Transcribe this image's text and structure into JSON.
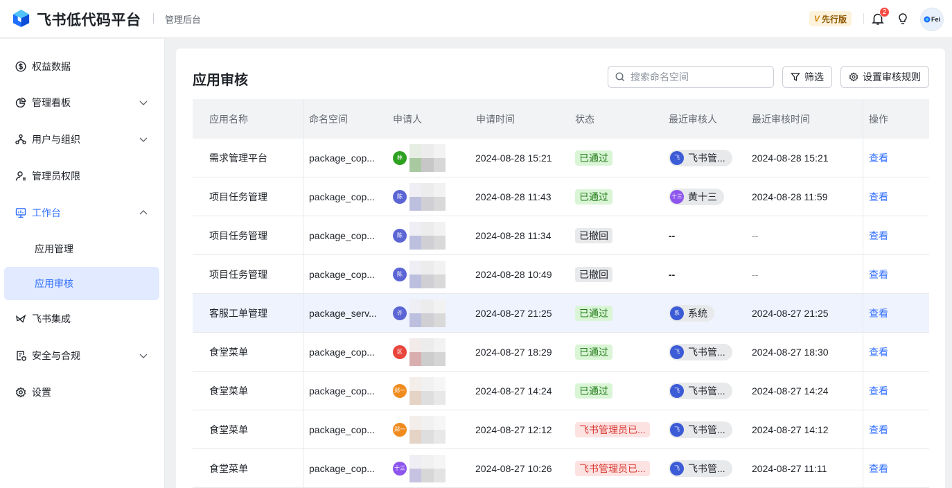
{
  "header": {
    "brand": "飞书低代码平台",
    "admin_label": "管理后台",
    "edition_mark": "V",
    "edition_label": "先行版",
    "notification_count": "2",
    "avatar_text": "Fei"
  },
  "sidebar": {
    "items": [
      {
        "label": "权益数据",
        "icon": "dollar-circle-icon"
      },
      {
        "label": "管理看板",
        "icon": "pie-chart-icon",
        "expandable": true
      },
      {
        "label": "用户与组织",
        "icon": "org-icon",
        "expandable": true
      },
      {
        "label": "管理员权限",
        "icon": "admin-user-icon"
      },
      {
        "label": "工作台",
        "icon": "monitor-icon",
        "expanded": true
      },
      {
        "label": "应用管理"
      },
      {
        "label": "应用审核",
        "selected": true
      },
      {
        "label": "飞书集成",
        "icon": "integration-icon"
      },
      {
        "label": "安全与合规",
        "icon": "shield-doc-icon",
        "expandable": true
      },
      {
        "label": "设置",
        "icon": "gear-icon"
      }
    ]
  },
  "main": {
    "title": "应用审核",
    "search_placeholder": "搜索命名空间",
    "filter_label": "筛选",
    "rules_label": "设置审核规则",
    "columns": [
      "应用名称",
      "命名空间",
      "申请人",
      "申请时间",
      "状态",
      "最近审核人",
      "最近审核时间",
      "操作"
    ],
    "rows": [
      {
        "app": "需求管理平台",
        "ns": "package_cop...",
        "applicant_initial": "林",
        "applicant_color": "#2ea121",
        "time": "2024-08-28 15:21",
        "status": "已通过",
        "status_type": "ok",
        "reviewer": "飞书管...",
        "reviewer_initial": "飞",
        "reviewer_color": "#3c5bd6",
        "review_time": "2024-08-28 15:21",
        "action": "查看"
      },
      {
        "app": "项目任务管理",
        "ns": "package_cop...",
        "applicant_initial": "陈",
        "applicant_color": "#5b65d4",
        "time": "2024-08-28 11:43",
        "status": "已通过",
        "status_type": "ok",
        "reviewer": "黄十三",
        "reviewer_initial": "十三",
        "reviewer_color": "#8d55ed",
        "review_time": "2024-08-28 11:59",
        "action": "查看"
      },
      {
        "app": "项目任务管理",
        "ns": "package_cop...",
        "applicant_initial": "陈",
        "applicant_color": "#5b65d4",
        "time": "2024-08-28 11:34",
        "status": "已撤回",
        "status_type": "back",
        "reviewer": "--",
        "review_time": "--",
        "action": "查看"
      },
      {
        "app": "项目任务管理",
        "ns": "package_cop...",
        "applicant_initial": "陈",
        "applicant_color": "#5b65d4",
        "time": "2024-08-28 10:49",
        "status": "已撤回",
        "status_type": "back",
        "reviewer": "--",
        "review_time": "--",
        "action": "查看"
      },
      {
        "app": "客服工单管理",
        "ns": "package_serv...",
        "applicant_initial": "许",
        "applicant_color": "#5b65d4",
        "time": "2024-08-27 21:25",
        "status": "已通过",
        "status_type": "ok",
        "reviewer": "系统",
        "reviewer_initial": "系",
        "reviewer_color": "#3c5bd6",
        "review_time": "2024-08-27 21:25",
        "action": "查看",
        "highlighted": true
      },
      {
        "app": "食堂菜单",
        "ns": "package_cop...",
        "applicant_initial": "区",
        "applicant_color": "#e8453c",
        "time": "2024-08-27 18:29",
        "status": "已通过",
        "status_type": "ok",
        "reviewer": "飞书管...",
        "reviewer_initial": "飞",
        "reviewer_color": "#3c5bd6",
        "review_time": "2024-08-27 18:30",
        "action": "查看"
      },
      {
        "app": "食堂菜单",
        "ns": "package_cop...",
        "applicant_initial": "郑一",
        "applicant_color": "#f08c1f",
        "time": "2024-08-27 14:24",
        "status": "已通过",
        "status_type": "ok",
        "reviewer": "飞书管...",
        "reviewer_initial": "飞",
        "reviewer_color": "#3c5bd6",
        "review_time": "2024-08-27 14:24",
        "action": "查看"
      },
      {
        "app": "食堂菜单",
        "ns": "package_cop...",
        "applicant_initial": "郑一",
        "applicant_color": "#f08c1f",
        "time": "2024-08-27 12:12",
        "status": "飞书管理员已...",
        "status_type": "fail",
        "reviewer": "飞书管...",
        "reviewer_initial": "飞",
        "reviewer_color": "#3c5bd6",
        "review_time": "2024-08-27 14:12",
        "action": "查看"
      },
      {
        "app": "食堂菜单",
        "ns": "package_cop...",
        "applicant_initial": "十三",
        "applicant_color": "#8d55ed",
        "time": "2024-08-27 10:26",
        "status": "飞书管理员已...",
        "status_type": "fail",
        "reviewer": "飞书管...",
        "reviewer_initial": "飞",
        "reviewer_color": "#3c5bd6",
        "review_time": "2024-08-27 11:11",
        "action": "查看"
      }
    ]
  }
}
